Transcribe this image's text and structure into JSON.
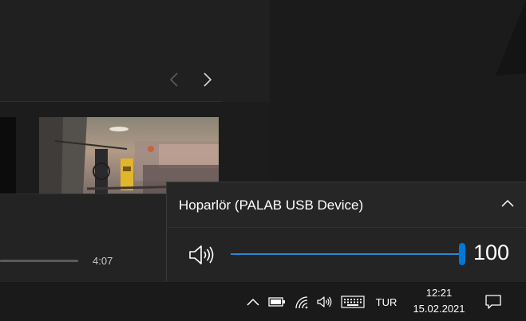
{
  "background_app": {
    "seek_time": "4:07"
  },
  "volume_flyout": {
    "device_name": "Hoparlör (PALAB USB Device)",
    "volume_value": "100",
    "volume_level_percent": 100,
    "accent_color": "#0078d7"
  },
  "taskbar": {
    "language": "TUR",
    "time": "12:21",
    "date": "15.02.2021",
    "icons": [
      "chevron-up-icon",
      "battery-icon",
      "wifi-icon",
      "speaker-icon",
      "keyboard-icon",
      "notification-icon"
    ]
  }
}
